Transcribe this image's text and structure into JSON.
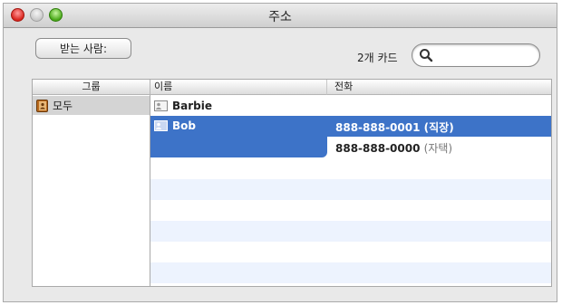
{
  "window": {
    "title": "주소"
  },
  "toolbar": {
    "to_button_label": "받는 사람:",
    "card_count": "2개 카드",
    "search": {
      "value": "",
      "placeholder": ""
    }
  },
  "columns": {
    "group": "그룹",
    "name": "이름",
    "phone": "전화"
  },
  "groups": [
    {
      "label": "모두",
      "icon": "address-book-icon",
      "selected": true
    }
  ],
  "contacts": [
    {
      "name": "Barbie",
      "icon": "card-icon",
      "selected": false,
      "phones": []
    },
    {
      "name": "Bob",
      "icon": "card-icon",
      "selected": true,
      "phones": [
        {
          "number": "888-888-0001",
          "tag": "(직장)"
        },
        {
          "number": "888-888-0000",
          "tag": "(자택)"
        }
      ]
    }
  ],
  "colors": {
    "selection": "#3d73c8",
    "stripe": "#edf3fe",
    "close": "#d9241c",
    "zoom": "#49a818"
  }
}
